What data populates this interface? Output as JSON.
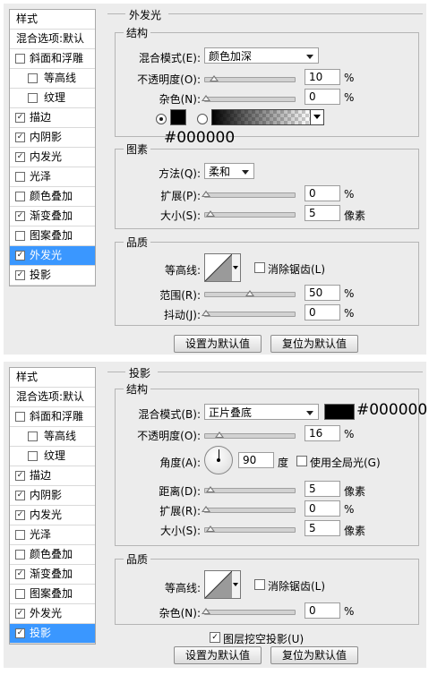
{
  "sidebar_items": [
    {
      "label": "样式",
      "kind": "head",
      "checked": null
    },
    {
      "label": "混合选项:默认",
      "kind": "head",
      "checked": null
    },
    {
      "label": "斜面和浮雕",
      "kind": "top",
      "checked": false
    },
    {
      "label": "等高线",
      "kind": "sub",
      "checked": false
    },
    {
      "label": "纹理",
      "kind": "sub",
      "checked": false
    },
    {
      "label": "描边",
      "kind": "top",
      "checked": true
    },
    {
      "label": "内阴影",
      "kind": "top",
      "checked": true
    },
    {
      "label": "内发光",
      "kind": "top",
      "checked": true
    },
    {
      "label": "光泽",
      "kind": "top",
      "checked": false
    },
    {
      "label": "颜色叠加",
      "kind": "top",
      "checked": false
    },
    {
      "label": "渐变叠加",
      "kind": "top",
      "checked": true
    },
    {
      "label": "图案叠加",
      "kind": "top",
      "checked": false
    },
    {
      "label": "外发光",
      "kind": "top",
      "checked": true
    },
    {
      "label": "投影",
      "kind": "top",
      "checked": true
    }
  ],
  "outer_glow": {
    "title": "外发光",
    "structure_label": "结构",
    "blend_mode_label": "混合模式(E):",
    "blend_mode_value": "颜色加深",
    "opacity_label": "不透明度(O):",
    "opacity_value": "10",
    "noise_label": "杂色(N):",
    "noise_value": "0",
    "percent": "%",
    "color_hex": "#000000",
    "elements_label": "图素",
    "technique_label": "方法(Q):",
    "technique_value": "柔和",
    "spread_label": "扩展(P):",
    "spread_value": "0",
    "size_label": "大小(S):",
    "size_value": "5",
    "px_unit": "像素",
    "quality_label": "品质",
    "contour_label": "等高线:",
    "antialias_label": "消除锯齿(L)",
    "range_label": "范围(R):",
    "range_value": "50",
    "jitter_label": "抖动(J):",
    "jitter_value": "0",
    "make_default": "设置为默认值",
    "reset_default": "复位为默认值"
  },
  "drop_shadow": {
    "title": "投影",
    "structure_label": "结构",
    "blend_mode_label": "混合模式(B):",
    "blend_mode_value": "正片叠底",
    "color_hex": "#000000",
    "opacity_label": "不透明度(O):",
    "opacity_value": "16",
    "percent": "%",
    "angle_label": "角度(A):",
    "angle_value": "90",
    "degree": "度",
    "global_light_label": "使用全局光(G)",
    "distance_label": "距离(D):",
    "distance_value": "5",
    "spread_label": "扩展(R):",
    "spread_value": "0",
    "size_label": "大小(S):",
    "size_value": "5",
    "px_unit": "像素",
    "quality_label": "品质",
    "contour_label": "等高线:",
    "antialias_label": "消除锯齿(L)",
    "noise_label": "杂色(N):",
    "noise_value": "0",
    "knockout_label": "图层挖空投影(U)",
    "make_default": "设置为默认值",
    "reset_default": "复位为默认值"
  }
}
